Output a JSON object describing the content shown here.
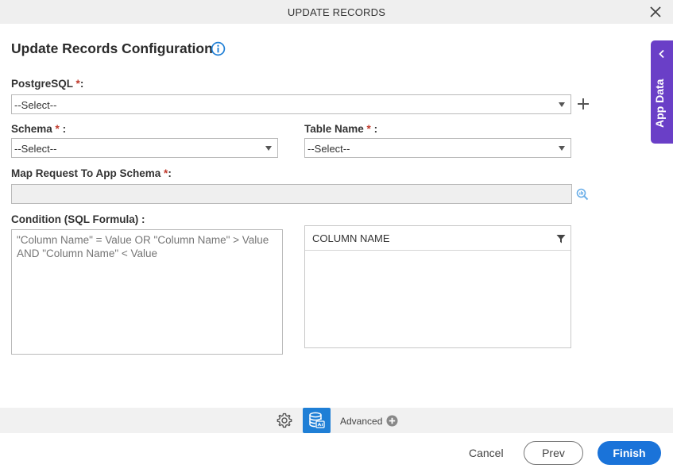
{
  "dialog": {
    "title": "UPDATE RECORDS",
    "heading": "Update Records Configuration"
  },
  "fields": {
    "postgresql": {
      "label": "PostgreSQL",
      "required_mark": "*",
      "suffix": ":",
      "value": "--Select--"
    },
    "schema": {
      "label": "Schema",
      "required_mark": "*",
      "suffix": ":",
      "value": "--Select--"
    },
    "table_name": {
      "label": "Table Name",
      "required_mark": "*",
      "suffix": ":",
      "value": "--Select--"
    },
    "map_request": {
      "label": "Map Request To App Schema",
      "required_mark": "*",
      "suffix": ":",
      "value": ""
    },
    "condition": {
      "label": "Condition (SQL Formula) :",
      "placeholder": "\"Column Name\" = Value OR \"Column Name\" > Value AND \"Column Name\" < Value"
    }
  },
  "column_panel": {
    "header": "COLUMN NAME"
  },
  "side_tab": {
    "label": "App Data"
  },
  "toolbar": {
    "advanced_label": "Advanced"
  },
  "footer": {
    "cancel": "Cancel",
    "prev": "Prev",
    "finish": "Finish"
  },
  "colors": {
    "accent_blue": "#1a73d9",
    "side_tab_purple": "#6a3fc7",
    "required_red": "#c0392b"
  },
  "icons": [
    "close-icon",
    "info-icon",
    "plus-icon",
    "map-search-icon",
    "filter-icon",
    "chevron-left-icon",
    "gear-icon",
    "database-icon",
    "add-circle-icon"
  ]
}
